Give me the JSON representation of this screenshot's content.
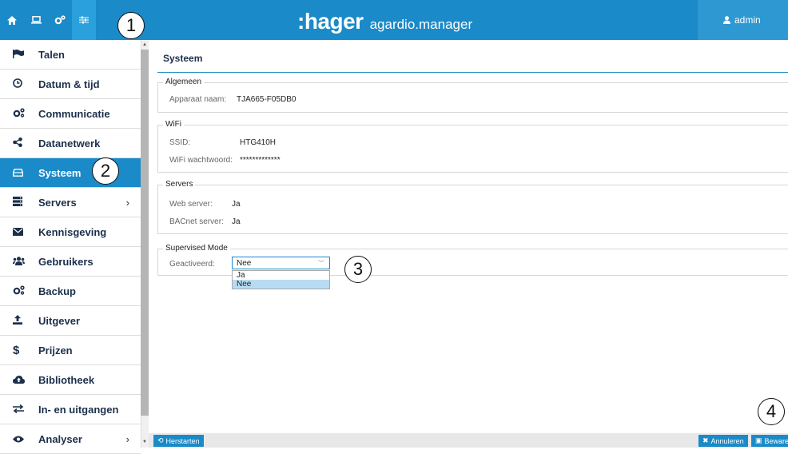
{
  "top_nav": {
    "icons": [
      "home-icon",
      "laptop-icon",
      "settings-icon",
      "sliders-icon"
    ],
    "brand_logo": ":hager",
    "brand_product": "agardio.manager",
    "user": "admin"
  },
  "callouts": [
    "1",
    "2",
    "3",
    "4"
  ],
  "sidebar": {
    "items": [
      {
        "label": "Talen",
        "icon": "flag-icon"
      },
      {
        "label": "Datum & tijd",
        "icon": "clock-icon"
      },
      {
        "label": "Communicatie",
        "icon": "cogs-icon"
      },
      {
        "label": "Datanetwerk",
        "icon": "share-icon"
      },
      {
        "label": "Systeem",
        "icon": "hdd-icon",
        "active": true
      },
      {
        "label": "Servers",
        "icon": "server-icon",
        "arrow": "›"
      },
      {
        "label": "Kennisgeving",
        "icon": "envelope-icon"
      },
      {
        "label": "Gebruikers",
        "icon": "users-icon"
      },
      {
        "label": "Backup",
        "icon": "cogs-icon"
      },
      {
        "label": "Uitgever",
        "icon": "upload-icon"
      },
      {
        "label": "Prijzen",
        "icon": "dollar-icon"
      },
      {
        "label": "Bibliotheek",
        "icon": "cloud-upload-icon"
      },
      {
        "label": "In- en uitgangen",
        "icon": "exchange-icon"
      },
      {
        "label": "Analyser",
        "icon": "eye-icon",
        "arrow": "›"
      }
    ]
  },
  "main": {
    "title": "Systeem",
    "general": {
      "legend": "Algemeen",
      "device_label": "Apparaat naam:",
      "device_value": "TJA665-F05DB0"
    },
    "wifi": {
      "legend": "WiFi",
      "ssid_label": "SSID:",
      "ssid_value": "HTG410H",
      "password_label": "WiFi wachtwoord:",
      "password_value": "*************"
    },
    "servers": {
      "legend": "Servers",
      "web_label": "Web server:",
      "web_value": "Ja",
      "bacnet_label": "BACnet server:",
      "bacnet_value": "Ja"
    },
    "supervised": {
      "legend": "Supervised Mode",
      "activated_label": "Geactiveerd:",
      "selected": "Nee",
      "options": [
        "Ja",
        "Nee"
      ]
    }
  },
  "footer": {
    "restart": "Herstarten",
    "cancel": "Annuleren",
    "save": "Bewaren"
  },
  "colors": {
    "accent": "#1a8ac8",
    "nav_text": "#1c2f4a"
  }
}
